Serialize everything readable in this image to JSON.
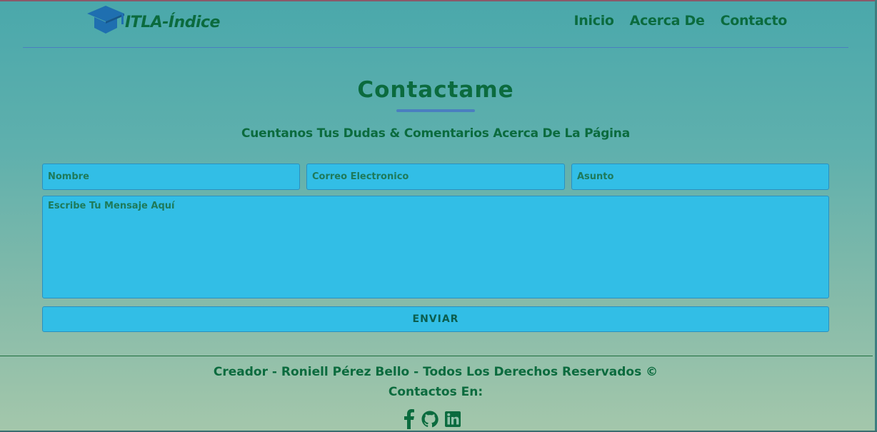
{
  "header": {
    "logo_text": "ITLA-Índice",
    "nav": [
      "Inicio",
      "Acerca De",
      "Contacto"
    ]
  },
  "main": {
    "title": "Contactame",
    "subtitle": "Cuentanos Tus Dudas & Comentarios Acerca De La Página",
    "form": {
      "name_placeholder": "Nombre",
      "email_placeholder": "Correo Electronico",
      "subject_placeholder": "Asunto",
      "message_placeholder": "Escribe Tu Mensaje Aquí",
      "submit_label": "ENVIAR"
    }
  },
  "footer": {
    "credit": "Creador - Roniell Pérez Bello - Todos Los Derechos Reservados ©",
    "contacts_label": "Contactos En:",
    "socials": [
      "facebook-icon",
      "github-icon",
      "linkedin-icon"
    ]
  },
  "colors": {
    "text_green": "#0b6b3e",
    "input_blue": "#32bee6",
    "accent_blue": "#4a7fc0"
  }
}
